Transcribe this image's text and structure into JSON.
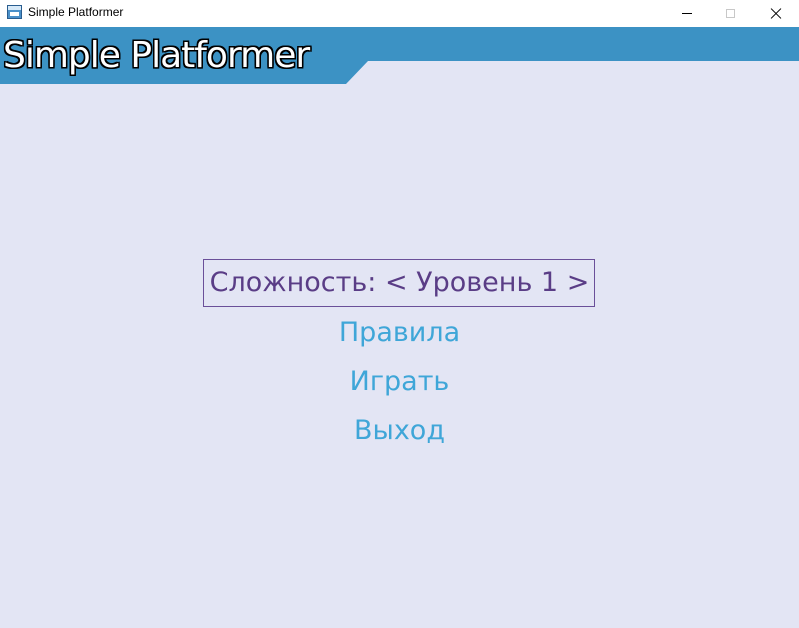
{
  "window": {
    "title": "Simple Platformer",
    "icon": "app-window-icon",
    "controls": {
      "minimize_icon": "minimize-icon",
      "maximize_icon": "maximize-icon",
      "close_icon": "close-icon"
    }
  },
  "game": {
    "title": "Simple Platformer",
    "colors": {
      "background": "#e3e5f4",
      "header_banner": "#3c92c4",
      "menu_text": "#3fa6d8",
      "selected_text": "#5a3d86",
      "selected_border": "#6a4f99"
    },
    "menu": {
      "difficulty": "Сложность: < Уровень 1 >",
      "rules": "Правила",
      "play": "Играть",
      "exit": "Выход",
      "selected": "difficulty"
    }
  }
}
